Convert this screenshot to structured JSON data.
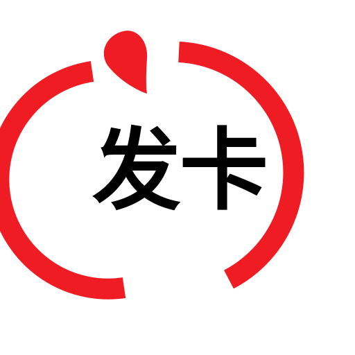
{
  "logo": {
    "text": "发卡",
    "icon": "power-ring-icon",
    "colors": {
      "ring": "#ef1c24",
      "text": "#000000",
      "background": "#ffffff"
    }
  }
}
